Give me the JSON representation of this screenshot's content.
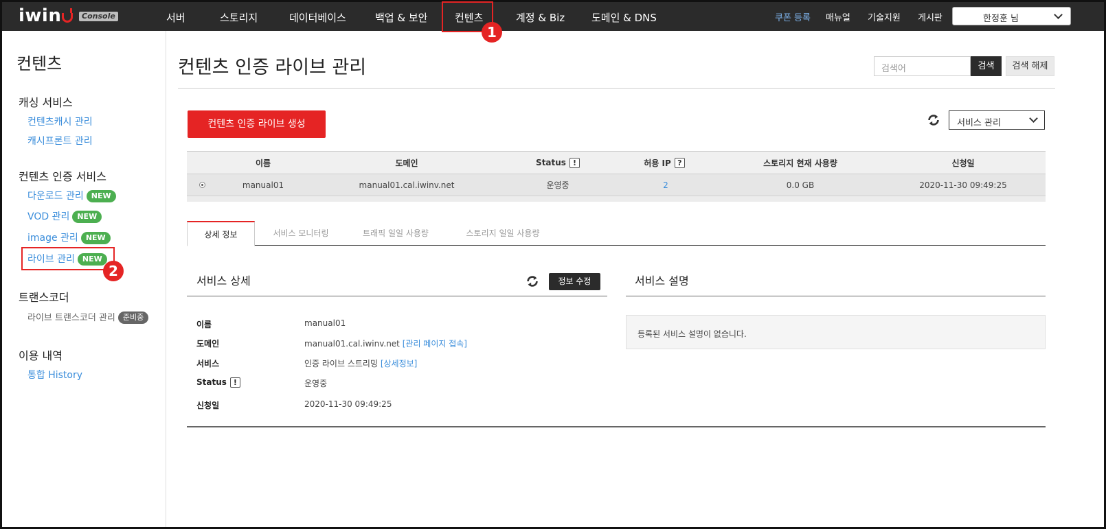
{
  "header": {
    "logo": "iwin",
    "console_tag": "Console",
    "nav": [
      "서버",
      "스토리지",
      "데이터베이스",
      "백업 & 보안",
      "컨텐츠",
      "계정 & Biz",
      "도메인 & DNS"
    ],
    "right_links": [
      "쿠폰 등록",
      "매뉴얼",
      "기술지원",
      "게시판"
    ],
    "user": "한정훈 님",
    "accent_color": "#7fb5ef"
  },
  "markers": [
    "1",
    "2"
  ],
  "sidebar": {
    "title": "컨텐츠",
    "sections": [
      {
        "title": "캐싱 서비스",
        "links": [
          "컨텐츠캐시 관리",
          "캐시프론트 관리"
        ]
      },
      {
        "title": "컨텐츠 인증 서비스",
        "links": [
          "다운로드 관리",
          "VOD 관리",
          "image 관리",
          "라이브 관리"
        ],
        "badge": "NEW"
      },
      {
        "title": "트랜스코더",
        "links": [
          "라이브 트랜스코더 관리"
        ],
        "badge": "준비중"
      },
      {
        "title": "이용 내역",
        "links": [
          "통합 History"
        ]
      }
    ]
  },
  "main": {
    "title": "컨텐츠 인증 라이브 관리",
    "search": {
      "placeholder": "검색어",
      "button": "검색",
      "clear": "검색 해제"
    },
    "create_button": "컨텐츠 인증 라이브 생성",
    "service_select": "서비스 관리",
    "table": {
      "headers": [
        "이름",
        "도메인",
        "Status",
        "허용 IP",
        "스토리지 현재 사용량",
        "신청일"
      ],
      "status_hint": "!",
      "ip_hint": "?",
      "rows": [
        {
          "name": "manual01",
          "domain": "manual01.cal.iwinv.net",
          "status": "운영중",
          "allowed_ip": "2",
          "storage": "0.0 GB",
          "date": "2020-11-30 09:49:25"
        }
      ]
    },
    "tabs": [
      "상세 정보",
      "서비스 모니터링",
      "트래픽 일일 사용량",
      "스토리지 일일 사용량"
    ],
    "detail": {
      "title": "서비스 상세",
      "edit_button": "정보 수정",
      "fields": [
        {
          "label": "이름",
          "value": "manual01"
        },
        {
          "label": "도메인",
          "value": "manual01.cal.iwinv.net",
          "link": "[관리 페이지 접속]"
        },
        {
          "label": "서비스",
          "value": "인증 라이브 스트리밍",
          "link": "[상세정보]"
        },
        {
          "label": "Status",
          "value": "운영중"
        },
        {
          "label": "신청일",
          "value": "2020-11-30 09:49:25"
        }
      ]
    },
    "description": {
      "title": "서비스 설명",
      "text": "등록된 서비스 설명이 없습니다."
    }
  }
}
